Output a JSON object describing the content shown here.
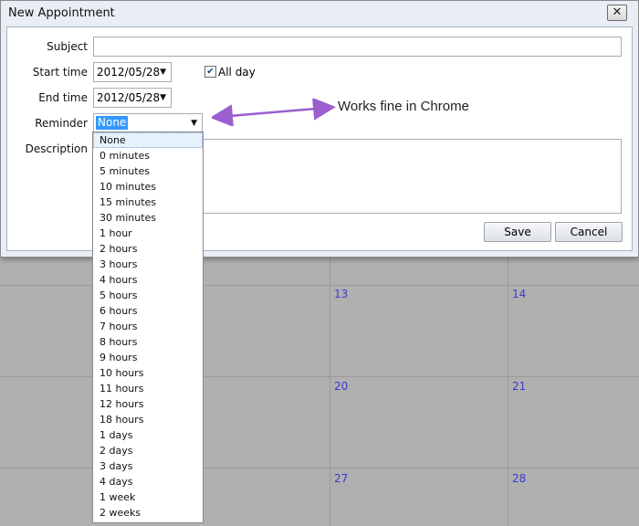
{
  "dialog": {
    "title": "New Appointment",
    "close_label": "✕"
  },
  "form": {
    "subject_label": "Subject",
    "subject_value": "",
    "start_label": "Start time",
    "start_value": "2012/05/28",
    "end_label": "End time",
    "end_value": "2012/05/28",
    "allday_label": "All day",
    "allday_checked": true,
    "reminder_label": "Reminder",
    "reminder_value": "None",
    "description_label": "Description"
  },
  "buttons": {
    "save": "Save",
    "cancel": "Cancel"
  },
  "reminder_options": [
    "None",
    "0 minutes",
    "5 minutes",
    "10 minutes",
    "15 minutes",
    "30 minutes",
    "1 hour",
    "2 hours",
    "3 hours",
    "4 hours",
    "5 hours",
    "6 hours",
    "7 hours",
    "8 hours",
    "9 hours",
    "10 hours",
    "11 hours",
    "12 hours",
    "18 hours",
    "1 days",
    "2 days",
    "3 days",
    "4 days",
    "1 week",
    "2 weeks"
  ],
  "annotation": {
    "text": "Works fine in Chrome",
    "color": "#9b5fd0"
  },
  "calendar": {
    "days": [
      "13",
      "14",
      "20",
      "21",
      "27",
      "28"
    ]
  }
}
